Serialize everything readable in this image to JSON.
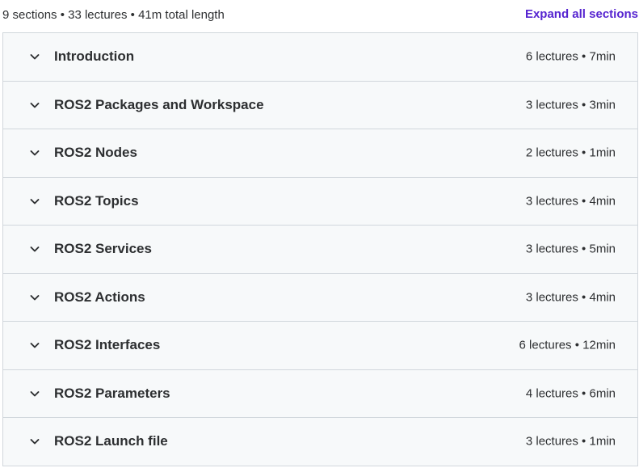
{
  "summary": {
    "text": "9 sections • 33 lectures • 41m total length",
    "expand_label": "Expand all sections"
  },
  "icons": {
    "section_toggle": "chevron-down-icon"
  },
  "colors": {
    "accent": "#5624d0",
    "section_bg": "#f7f9fa",
    "border": "#d1d7dc",
    "text": "#2d2f31"
  },
  "sections": [
    {
      "title": "Introduction",
      "meta": "6 lectures • 7min"
    },
    {
      "title": "ROS2 Packages and Workspace",
      "meta": "3 lectures • 3min"
    },
    {
      "title": "ROS2 Nodes",
      "meta": "2 lectures • 1min"
    },
    {
      "title": "ROS2 Topics",
      "meta": "3 lectures • 4min"
    },
    {
      "title": "ROS2 Services",
      "meta": "3 lectures • 5min"
    },
    {
      "title": "ROS2 Actions",
      "meta": "3 lectures • 4min"
    },
    {
      "title": "ROS2 Interfaces",
      "meta": "6 lectures • 12min"
    },
    {
      "title": "ROS2 Parameters",
      "meta": "4 lectures • 6min"
    },
    {
      "title": "ROS2 Launch file",
      "meta": "3 lectures • 1min"
    }
  ]
}
